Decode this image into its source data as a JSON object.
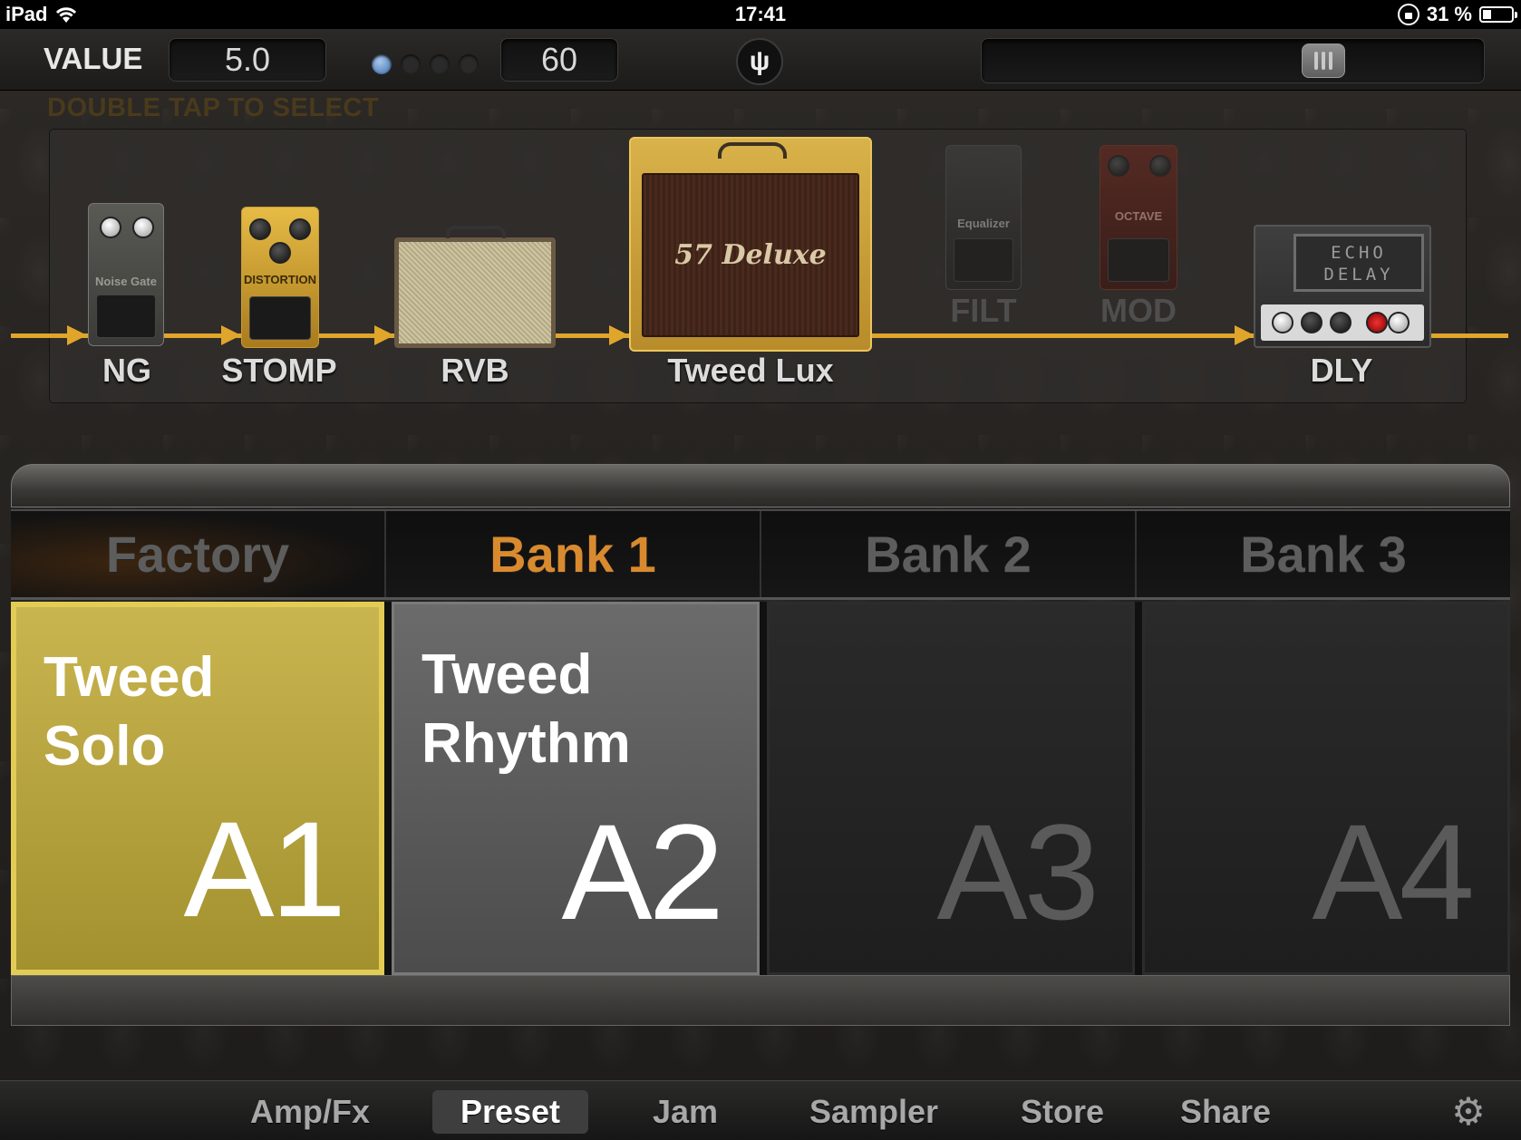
{
  "status_bar": {
    "device": "iPad",
    "time": "17:41",
    "battery": "31 %"
  },
  "toolbar": {
    "value_label": "VALUE",
    "value": "5.0",
    "tempo": "60",
    "beat_count": 4,
    "active_beat": 1,
    "volume_level_fraction": 0.7
  },
  "hint": "DOUBLE TAP TO SELECT",
  "chain": {
    "items": [
      {
        "label": "NG",
        "pedal_text": "Noise Gate"
      },
      {
        "label": "STOMP",
        "pedal_text": "DISTORTION"
      },
      {
        "label": "RVB"
      },
      {
        "label": "Tweed Lux",
        "amp_logo": "57 Deluxe"
      },
      {
        "label": "FILT",
        "pedal_text": "Equalizer"
      },
      {
        "label": "MOD",
        "pedal_text": "OCTAVE"
      },
      {
        "label": "DLY",
        "unit_text": "ECHO DELAY"
      }
    ]
  },
  "banks": [
    "Factory",
    "Bank 1",
    "Bank 2",
    "Bank 3"
  ],
  "active_bank": "Bank 1",
  "presets": [
    {
      "name": "Tweed Solo",
      "slot": "A1"
    },
    {
      "name": "Tweed Rhythm",
      "slot": "A2"
    },
    {
      "name": "",
      "slot": "A3"
    },
    {
      "name": "",
      "slot": "A4"
    }
  ],
  "tabs": [
    "Amp/Fx",
    "Preset",
    "Jam",
    "Sampler",
    "Store",
    "Share"
  ],
  "active_tab": "Preset",
  "colors": {
    "accent_gold": "#e3cc55",
    "signal_line": "#e0a52b",
    "active_bank_text": "#d98a2f",
    "beat_led": "#3c6fa8"
  }
}
